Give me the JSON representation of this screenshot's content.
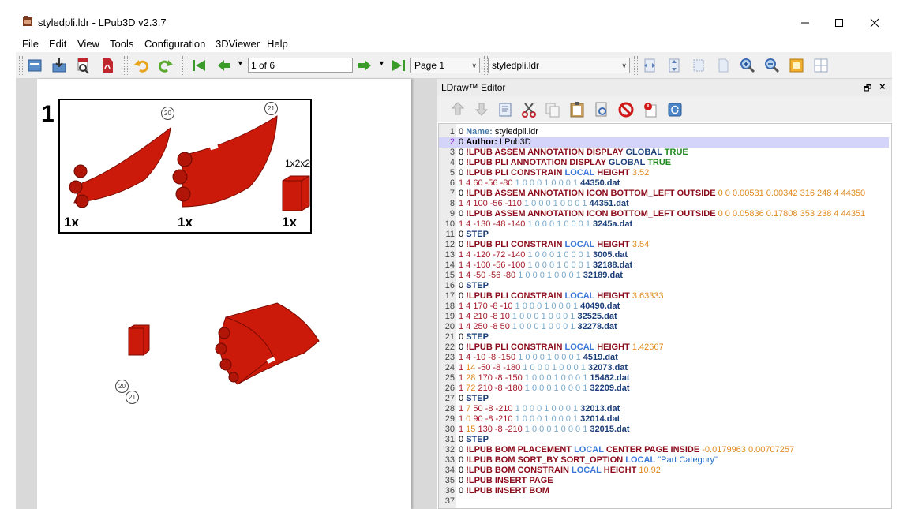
{
  "window": {
    "title": "styledpli.ldr - LPub3D v2.3.7"
  },
  "menu": [
    "File",
    "Edit",
    "View",
    "Tools",
    "Configuration",
    "3DViewer",
    "Help"
  ],
  "toolbar": {
    "page_field": "1 of 6",
    "page_combo": "Page 1",
    "file_combo": "styledpli.ldr"
  },
  "page_view": {
    "step_number": "1",
    "pli": [
      {
        "callout": "20",
        "qty": "1x"
      },
      {
        "callout": "21",
        "qty": "1x"
      },
      {
        "size": "1x2x2",
        "qty": "1x"
      }
    ],
    "model_callouts": [
      "20",
      "21"
    ]
  },
  "colors": {
    "brick_red": "#cc1a0a",
    "keyword": "#8b0a1a",
    "local_blue": "#3a78d8",
    "true_green": "#1e8a1e",
    "number_orange": "#e08a1e"
  },
  "editor": {
    "title": "LDraw™ Editor",
    "lines": [
      {
        "n": "1",
        "seg": [
          [
            "t",
            "0 "
          ],
          [
            "nm",
            "Name:"
          ],
          [
            "t",
            " styledpli.ldr"
          ]
        ]
      },
      {
        "n": "2",
        "hl": true,
        "seg": [
          [
            "t",
            "0 "
          ],
          [
            "bb",
            "Author:"
          ],
          [
            "t",
            " LPub3D"
          ]
        ]
      },
      {
        "n": "3",
        "seg": [
          [
            "t",
            "0 "
          ],
          [
            "k",
            "!LPUB ASSEM ANNOTATION DISPLAY "
          ],
          [
            "pf",
            "GLOBAL"
          ],
          [
            "g",
            " TRUE"
          ]
        ]
      },
      {
        "n": "4",
        "seg": [
          [
            "t",
            "0 "
          ],
          [
            "k",
            "!LPUB PLI ANNOTATION DISPLAY "
          ],
          [
            "pf",
            "GLOBAL"
          ],
          [
            "g",
            " TRUE"
          ]
        ]
      },
      {
        "n": "5",
        "seg": [
          [
            "t",
            "0 "
          ],
          [
            "k",
            "!LPUB PLI CONSTRAIN "
          ],
          [
            "b",
            "LOCAL"
          ],
          [
            "k",
            " HEIGHT"
          ],
          [
            "o",
            " 3.52"
          ]
        ]
      },
      {
        "n": "6",
        "seg": [
          [
            "n",
            "1 4"
          ],
          [
            "n",
            " 60 -56 -80"
          ],
          [
            "cy",
            " 1 0 0 0 1 0 0 0 1"
          ],
          [
            "pf",
            " 44350.dat"
          ]
        ]
      },
      {
        "n": "7",
        "seg": [
          [
            "t",
            "0 "
          ],
          [
            "k",
            "!LPUB ASSEM ANNOTATION ICON BOTTOM_LEFT OUTSIDE"
          ],
          [
            "o",
            " 0 0 0.00531 0.00342 316 248 4 44350"
          ]
        ]
      },
      {
        "n": "8",
        "seg": [
          [
            "n",
            "1 4"
          ],
          [
            "n",
            " 100 -56 -110"
          ],
          [
            "cy",
            " 1 0 0 0 1 0 0 0 1"
          ],
          [
            "pf",
            " 44351.dat"
          ]
        ]
      },
      {
        "n": "9",
        "seg": [
          [
            "t",
            "0 "
          ],
          [
            "k",
            "!LPUB ASSEM ANNOTATION ICON BOTTOM_LEFT OUTSIDE"
          ],
          [
            "o",
            " 0 0 0.05836 0.17808 353 238 4 44351"
          ]
        ]
      },
      {
        "n": "10",
        "seg": [
          [
            "n",
            "1 4"
          ],
          [
            "n",
            " -130 -48 -140"
          ],
          [
            "cy",
            " 1 0 0 0 1 0 0 0 1"
          ],
          [
            "pf",
            " 3245a.dat"
          ]
        ]
      },
      {
        "n": "11",
        "seg": [
          [
            "t",
            "0 "
          ],
          [
            "pf",
            "STEP"
          ]
        ]
      },
      {
        "n": "12",
        "seg": [
          [
            "t",
            "0 "
          ],
          [
            "k",
            "!LPUB PLI CONSTRAIN "
          ],
          [
            "b",
            "LOCAL"
          ],
          [
            "k",
            " HEIGHT"
          ],
          [
            "o",
            " 3.54"
          ]
        ]
      },
      {
        "n": "13",
        "seg": [
          [
            "n",
            "1 4"
          ],
          [
            "n",
            " -120 -72 -140"
          ],
          [
            "cy",
            " 1 0 0 0 1 0 0 0 1"
          ],
          [
            "pf",
            " 3005.dat"
          ]
        ]
      },
      {
        "n": "14",
        "seg": [
          [
            "n",
            "1 4"
          ],
          [
            "n",
            " -100 -56 -100"
          ],
          [
            "cy",
            " 1 0 0 0 1 0 0 0 1"
          ],
          [
            "pf",
            " 32188.dat"
          ]
        ]
      },
      {
        "n": "15",
        "seg": [
          [
            "n",
            "1 4"
          ],
          [
            "n",
            " -50 -56 -80"
          ],
          [
            "cy",
            " 1 0 0 0 1 0 0 0 1"
          ],
          [
            "pf",
            " 32189.dat"
          ]
        ]
      },
      {
        "n": "16",
        "seg": [
          [
            "t",
            "0 "
          ],
          [
            "pf",
            "STEP"
          ]
        ]
      },
      {
        "n": "17",
        "seg": [
          [
            "t",
            "0 "
          ],
          [
            "k",
            "!LPUB PLI CONSTRAIN "
          ],
          [
            "b",
            "LOCAL"
          ],
          [
            "k",
            " HEIGHT"
          ],
          [
            "o",
            " 3.63333"
          ]
        ]
      },
      {
        "n": "18",
        "seg": [
          [
            "n",
            "1 4"
          ],
          [
            "n",
            " 170 -8 -10"
          ],
          [
            "cy",
            " 1 0 0 0 1 0 0 0 1"
          ],
          [
            "pf",
            " 40490.dat"
          ]
        ]
      },
      {
        "n": "19",
        "seg": [
          [
            "n",
            "1 4"
          ],
          [
            "n",
            " 210 -8 10"
          ],
          [
            "cy",
            " 1 0 0 0 1 0 0 0 1"
          ],
          [
            "pf",
            " 32525.dat"
          ]
        ]
      },
      {
        "n": "20",
        "seg": [
          [
            "n",
            "1 4"
          ],
          [
            "n",
            " 250 -8 50"
          ],
          [
            "cy",
            " 1 0 0 0 1 0 0 0 1"
          ],
          [
            "pf",
            " 32278.dat"
          ]
        ]
      },
      {
        "n": "21",
        "seg": [
          [
            "t",
            "0 "
          ],
          [
            "pf",
            "STEP"
          ]
        ]
      },
      {
        "n": "22",
        "seg": [
          [
            "t",
            "0 "
          ],
          [
            "k",
            "!LPUB PLI CONSTRAIN "
          ],
          [
            "b",
            "LOCAL"
          ],
          [
            "k",
            " HEIGHT"
          ],
          [
            "o",
            " 1.42667"
          ]
        ]
      },
      {
        "n": "23",
        "seg": [
          [
            "n",
            "1 4"
          ],
          [
            "n",
            " -10 -8 -150"
          ],
          [
            "cy",
            " 1 0 0 0 1 0 0 0 1"
          ],
          [
            "pf",
            " 4519.dat"
          ]
        ]
      },
      {
        "n": "24",
        "seg": [
          [
            "n",
            "1"
          ],
          [
            "o",
            " 14"
          ],
          [
            "n",
            " -50 -8 -180"
          ],
          [
            "cy",
            " 1 0 0 0 1 0 0 0 1"
          ],
          [
            "pf",
            " 32073.dat"
          ]
        ]
      },
      {
        "n": "25",
        "seg": [
          [
            "n",
            "1"
          ],
          [
            "o",
            " 28"
          ],
          [
            "n",
            " 170 -8 -150"
          ],
          [
            "cy",
            " 1 0 0 0 1 0 0 0 1"
          ],
          [
            "pf",
            " 15462.dat"
          ]
        ]
      },
      {
        "n": "26",
        "seg": [
          [
            "n",
            "1"
          ],
          [
            "o",
            " 72"
          ],
          [
            "n",
            " 210 -8 -180"
          ],
          [
            "cy",
            " 1 0 0 0 1 0 0 0 1"
          ],
          [
            "pf",
            " 32209.dat"
          ]
        ]
      },
      {
        "n": "27",
        "seg": [
          [
            "t",
            "0 "
          ],
          [
            "pf",
            "STEP"
          ]
        ]
      },
      {
        "n": "28",
        "seg": [
          [
            "n",
            "1"
          ],
          [
            "o",
            " 7"
          ],
          [
            "n",
            " 50 -8 -210"
          ],
          [
            "cy",
            " 1 0 0 0 1 0 0 0 1"
          ],
          [
            "pf",
            " 32013.dat"
          ]
        ]
      },
      {
        "n": "29",
        "seg": [
          [
            "n",
            "1"
          ],
          [
            "o",
            " 0"
          ],
          [
            "n",
            " 90 -8 -210"
          ],
          [
            "cy",
            " 1 0 0 0 1 0 0 0 1"
          ],
          [
            "pf",
            " 32014.dat"
          ]
        ]
      },
      {
        "n": "30",
        "seg": [
          [
            "n",
            "1"
          ],
          [
            "o",
            " 15"
          ],
          [
            "n",
            " 130 -8 -210"
          ],
          [
            "cy",
            " 1 0 0 0 1 0 0 0 1"
          ],
          [
            "pf",
            " 32015.dat"
          ]
        ]
      },
      {
        "n": "31",
        "seg": [
          [
            "t",
            "0 "
          ],
          [
            "pf",
            "STEP"
          ]
        ]
      },
      {
        "n": "32",
        "seg": [
          [
            "t",
            "0 "
          ],
          [
            "k",
            "!LPUB BOM PLACEMENT "
          ],
          [
            "b",
            "LOCAL"
          ],
          [
            "k",
            " CENTER PAGE INSIDE"
          ],
          [
            "o",
            " -0.0179963 0.00707257"
          ]
        ]
      },
      {
        "n": "33",
        "seg": [
          [
            "t",
            "0 "
          ],
          [
            "k",
            "!LPUB BOM SORT_BY SORT_OPTION "
          ],
          [
            "b",
            "LOCAL"
          ],
          [
            "cc",
            " \"Part Category\""
          ]
        ]
      },
      {
        "n": "34",
        "seg": [
          [
            "t",
            "0 "
          ],
          [
            "k",
            "!LPUB BOM CONSTRAIN "
          ],
          [
            "b",
            "LOCAL"
          ],
          [
            "k",
            " HEIGHT"
          ],
          [
            "o",
            " 10.92"
          ]
        ]
      },
      {
        "n": "35",
        "seg": [
          [
            "t",
            "0 "
          ],
          [
            "k",
            "!LPUB INSERT PAGE"
          ]
        ]
      },
      {
        "n": "36",
        "seg": [
          [
            "t",
            "0 "
          ],
          [
            "k",
            "!LPUB INSERT BOM"
          ]
        ]
      },
      {
        "n": "37",
        "seg": []
      }
    ]
  }
}
